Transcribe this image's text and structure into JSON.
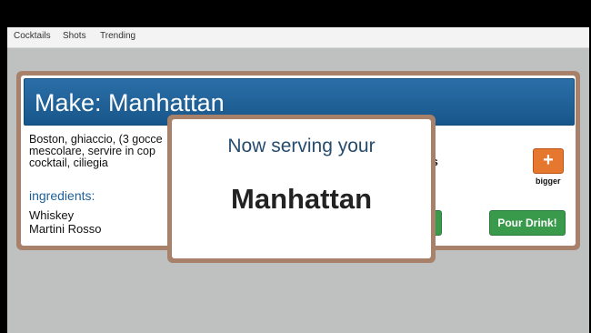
{
  "navbar": {
    "links": [
      "Cocktails",
      "Shots",
      "Trending"
    ]
  },
  "card": {
    "title": "Make: Manhattan",
    "description": "Boston, ghiaccio, (3 gocce\nmescolare, servire in cop\ncocktail, ciliegia",
    "ingredients_title": "ingredients:",
    "ingredients": [
      "Whiskey",
      "Martini Rosso"
    ],
    "size_label": "ers",
    "plus_button": "+",
    "plus_label": "bigger",
    "pour_button": "Pour Drink!"
  },
  "modal": {
    "subtitle": "Now serving your",
    "drink": "Manhattan"
  },
  "colors": {
    "header_blue": "#1f629a",
    "button_green": "#3a9a4c",
    "button_orange": "#e6772f",
    "card_frame": "#a8816a"
  }
}
